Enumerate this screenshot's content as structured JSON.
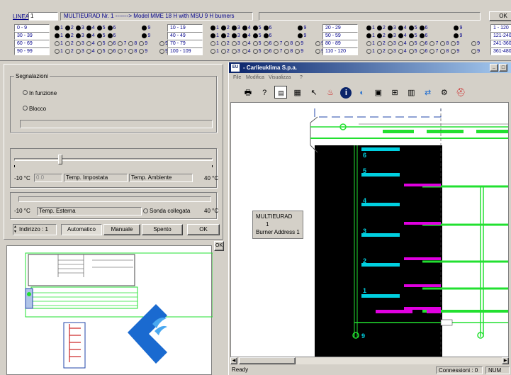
{
  "top": {
    "linea_label": "LINEA",
    "linea_value": "1",
    "model_title": "MULTIEURAD Nr. 1 -------> Model MME 18 H with MSU 9 H burners",
    "ok_label": "OK",
    "group1_ranges": [
      "0 - 9",
      "30 - 39",
      "60 - 69",
      "90 - 99"
    ],
    "group2_ranges": [
      "10 - 19",
      "40 - 49",
      "70 - 79",
      "100 - 109"
    ],
    "group3_ranges": [
      "20 - 29",
      "50 - 59",
      "80 - 89",
      "110 - 120"
    ],
    "group4_ranges": [
      "1 - 120",
      "121-240",
      "241-360",
      "361-480"
    ],
    "dot_digits": [
      "1",
      "2",
      "3",
      "4",
      "5",
      "6",
      "7",
      "8",
      "9"
    ],
    "single_dot_label": "9"
  },
  "panel": {
    "segnalazioni_label": "Segnalazioni",
    "in_funzione_label": "In funzione",
    "blocco_label": "Blocco",
    "min_temp": "-10 °C",
    "set_value": "0.0",
    "temp_impostata": "Temp. Impostata",
    "temp_ambiente": "Temp. Ambiente",
    "max_temp": "40 °C",
    "ext_min_temp": "-10 °C",
    "temp_esterna": "Temp. Esterna",
    "sonda_collegata": "Sonda collegata",
    "ext_max_temp": "40 °C",
    "indirizzo_label": "Indirizzo : 1",
    "automatico_label": "Automatico",
    "manuale_label": "Manuale",
    "spento_label": "Spento",
    "ok_label": "OK"
  },
  "preview": {
    "ok_label": "OK"
  },
  "app": {
    "title": "- Carlieuklima S.p.a.",
    "menu": [
      "File",
      "Modifica",
      "Visualizza",
      "?"
    ],
    "status_ready": "Ready",
    "status_connessioni": "Connessioni : 0",
    "status_num": "NUM",
    "tooltip_line1": "MULTIEURAD",
    "tooltip_line2": "1",
    "tooltip_line3": "Burner Address 1",
    "floor_labels": [
      "6",
      "5",
      "4",
      "3",
      "2",
      "1"
    ],
    "bottom_label": "9"
  },
  "colors": {
    "cyan": "#00d0e0",
    "green": "#22e030",
    "magenta": "#e000e0",
    "black": "#000000"
  }
}
